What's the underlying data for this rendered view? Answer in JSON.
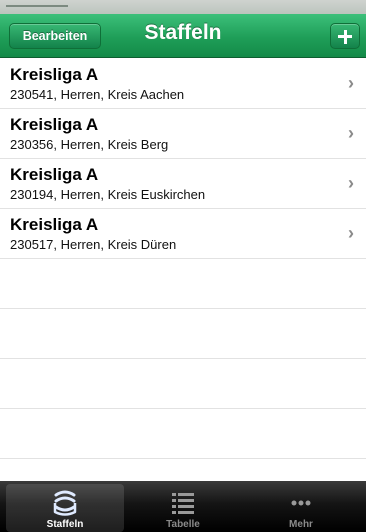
{
  "navbar": {
    "title": "Staffeln",
    "edit_label": "Bearbeiten",
    "add_icon": "plus-icon"
  },
  "rows": [
    {
      "title": "Kreisliga A",
      "subtitle": "230541, Herren, Kreis Aachen"
    },
    {
      "title": "Kreisliga A",
      "subtitle": "230356, Herren, Kreis Berg"
    },
    {
      "title": "Kreisliga A",
      "subtitle": "230194, Herren, Kreis Euskirchen"
    },
    {
      "title": "Kreisliga A",
      "subtitle": "230517, Herren, Kreis Düren"
    }
  ],
  "tabbar": {
    "tabs": [
      {
        "label": "Staffeln",
        "icon": "layers-icon",
        "active": true
      },
      {
        "label": "Tabelle",
        "icon": "list-icon",
        "active": false
      },
      {
        "label": "Mehr",
        "icon": "more-icon",
        "active": false
      }
    ]
  },
  "colors": {
    "navbar_green": "#1f9e58",
    "tabbar_black": "#141414"
  }
}
